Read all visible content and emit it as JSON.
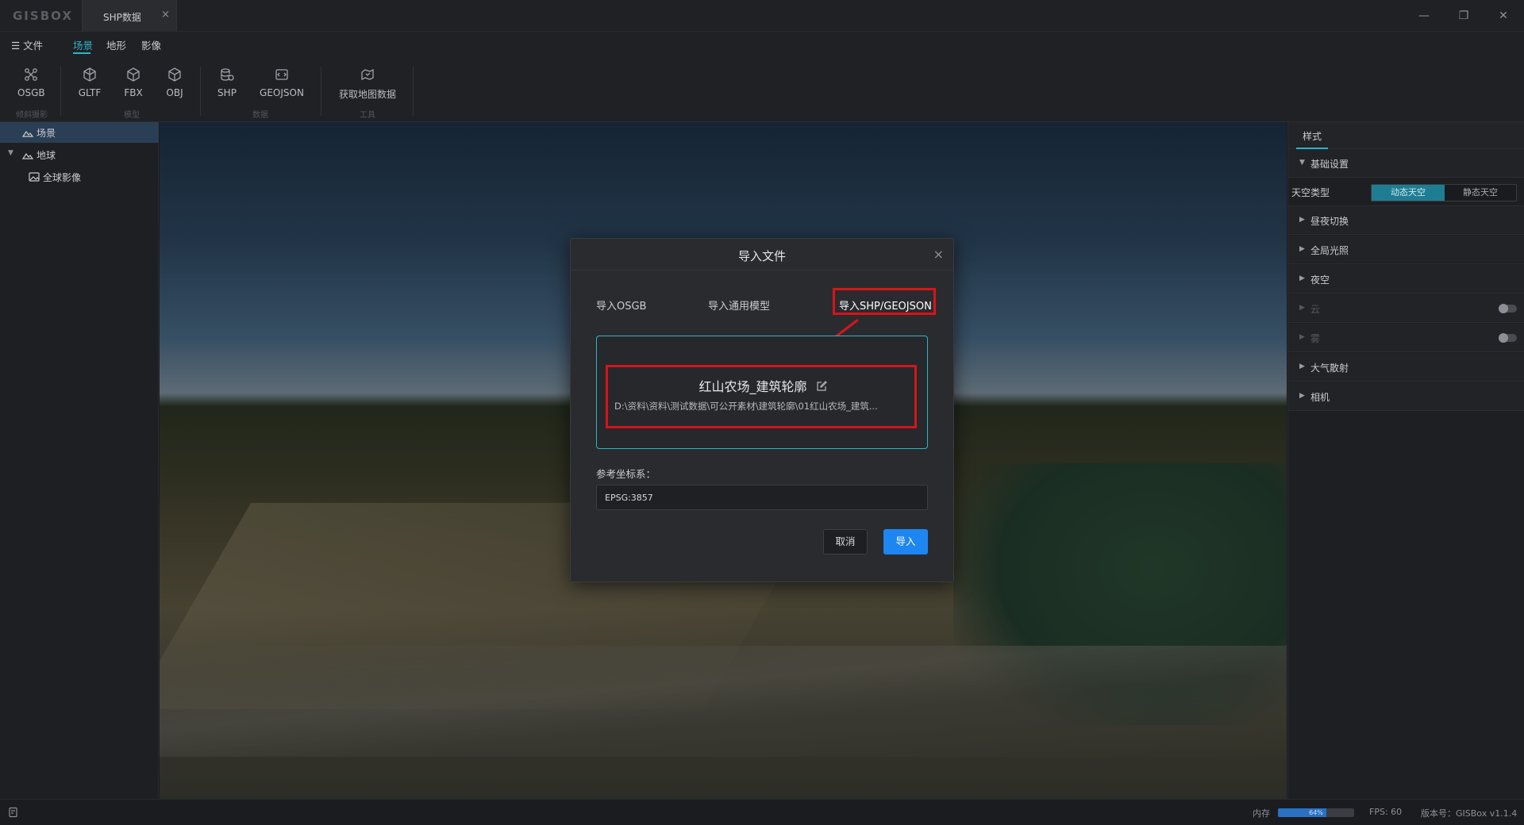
{
  "app": {
    "logo": "GISBOX",
    "doc_tab": "SHP数据",
    "window": {
      "minimize": "—",
      "restore": "❐",
      "close": "✕"
    }
  },
  "menu": {
    "file": "☰ 文件",
    "tabs": [
      {
        "label": "场景",
        "active": true
      },
      {
        "label": "地形",
        "active": false
      },
      {
        "label": "影像",
        "active": false
      }
    ]
  },
  "ribbon": {
    "tools": [
      {
        "label": "OSGB",
        "icon": "osgb-icon"
      },
      {
        "label": "GLTF",
        "icon": "gltf-icon"
      },
      {
        "label": "FBX",
        "icon": "fbx-icon"
      },
      {
        "label": "OBJ",
        "icon": "obj-icon"
      },
      {
        "label": "SHP",
        "icon": "shp-icon"
      },
      {
        "label": "GEOJSON",
        "icon": "geojson-icon"
      },
      {
        "label": "获取地图数据",
        "icon": "map-data-icon"
      }
    ],
    "groups": [
      "倾斜摄影",
      "模型",
      "数据",
      "工具"
    ]
  },
  "tree": {
    "items": [
      {
        "label": "场景",
        "selected": true
      },
      {
        "label": "地球",
        "expanded": true
      },
      {
        "label": "全球影像"
      }
    ]
  },
  "right_panel": {
    "tab": "样式",
    "sections": [
      {
        "label": "基础设置",
        "expanded": true
      },
      {
        "label": "昼夜切换"
      },
      {
        "label": "全局光照"
      },
      {
        "label": "夜空"
      },
      {
        "label": "云",
        "disabled": true,
        "toggle": false
      },
      {
        "label": "雾",
        "disabled": true,
        "toggle": false
      },
      {
        "label": "大气散射"
      },
      {
        "label": "相机"
      }
    ],
    "sky_type": {
      "label": "天空类型",
      "options": [
        "动态天空",
        "静态天空"
      ],
      "selected": "动态天空"
    }
  },
  "dialog": {
    "title": "导入文件",
    "tabs": [
      {
        "label": "导入OSGB"
      },
      {
        "label": "导入通用模型"
      },
      {
        "label": "导入SHP/GEOJSON",
        "active": true
      }
    ],
    "file": {
      "name": "红山农场_建筑轮廓",
      "path": "D:\\资料\\资料\\测试数据\\可公开素材\\建筑轮廓\\01红山农场_建筑..."
    },
    "crs": {
      "label": "参考坐标系：",
      "value": "EPSG:3857"
    },
    "buttons": {
      "cancel": "取消",
      "ok": "导入"
    }
  },
  "status": {
    "memory_label": "内存",
    "memory_text": "64%",
    "memory_percent": 64,
    "fps": "FPS: 60",
    "version": "版本号：GISBox v1.1.4"
  },
  "colors": {
    "accent": "#2fb4c7",
    "primary_button": "#1e86f0",
    "annotation": "#d5151b"
  }
}
